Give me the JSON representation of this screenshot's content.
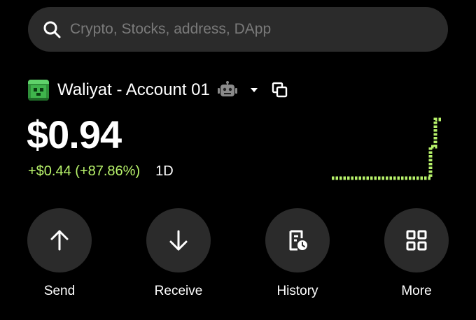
{
  "search": {
    "placeholder": "Crypto, Stocks, address, DApp"
  },
  "account": {
    "name": "Waliyat - Account 01"
  },
  "portfolio": {
    "balance": "$0.94",
    "change": "+$0.44 (+87.86%)",
    "period": "1D",
    "accent_color": "#b8f36b"
  },
  "actions": [
    {
      "label": "Send",
      "icon": "arrow-up-icon"
    },
    {
      "label": "Receive",
      "icon": "arrow-down-icon"
    },
    {
      "label": "History",
      "icon": "history-icon"
    },
    {
      "label": "More",
      "icon": "grid-icon"
    }
  ]
}
